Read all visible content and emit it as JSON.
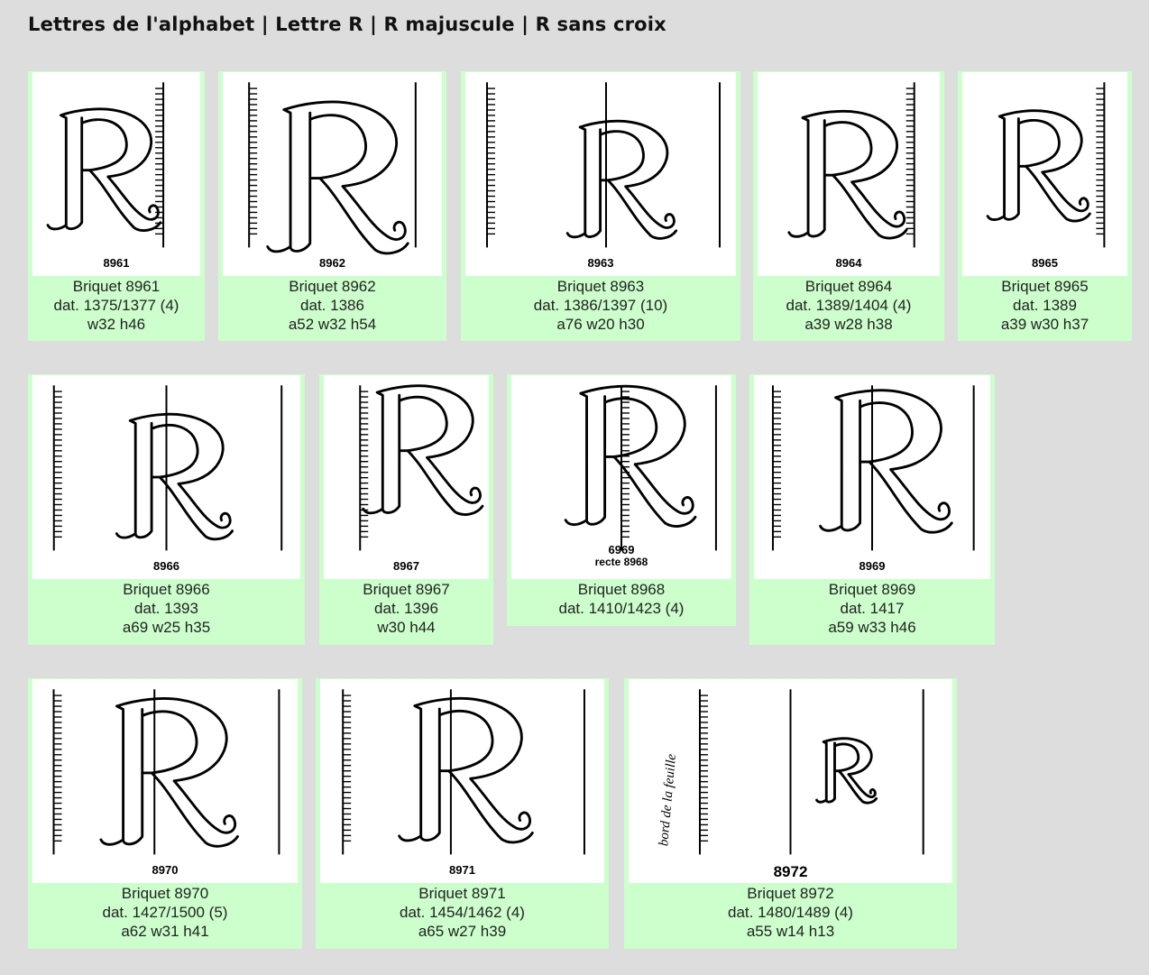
{
  "breadcrumb": "Lettres de l'alphabet | Lettre R | R majuscule | R sans croix",
  "cards": [
    {
      "number": "8961",
      "title": "Briquet 8961",
      "date": "dat. 1375/1377 (4)",
      "dims": "w32 h46"
    },
    {
      "number": "8962",
      "title": "Briquet 8962",
      "date": "dat. 1386",
      "dims": "a52 w32 h54"
    },
    {
      "number": "8963",
      "title": "Briquet 8963",
      "date": "dat. 1386/1397 (10)",
      "dims": "a76 w20 h30"
    },
    {
      "number": "8964",
      "title": "Briquet 8964",
      "date": "dat. 1389/1404 (4)",
      "dims": "a39 w28 h38"
    },
    {
      "number": "8965",
      "title": "Briquet 8965",
      "date": "dat. 1389",
      "dims": "a39 w30 h37"
    },
    {
      "number": "8966",
      "title": "Briquet 8966",
      "date": "dat. 1393",
      "dims": "a69 w25 h35"
    },
    {
      "number": "8967",
      "title": "Briquet 8967",
      "date": "dat. 1396",
      "dims": "w30 h44"
    },
    {
      "number": "6969",
      "recte": "recte 8968",
      "title": "Briquet 8968",
      "date": "dat. 1410/1423 (4)",
      "dims": ""
    },
    {
      "number": "8969",
      "title": "Briquet 8969",
      "date": "dat. 1417",
      "dims": "a59 w33 h46"
    },
    {
      "number": "8970",
      "title": "Briquet 8970",
      "date": "dat. 1427/1500 (5)",
      "dims": "a62 w31 h41"
    },
    {
      "number": "8971",
      "title": "Briquet 8971",
      "date": "dat. 1454/1462 (4)",
      "dims": "a65 w27 h39"
    },
    {
      "number": "8972",
      "title": "Briquet 8972",
      "date": "dat. 1480/1489 (4)",
      "dims": "a55 w14 h13",
      "margin_note": "bord de la feuille"
    }
  ],
  "colors": {
    "page_background": "#dddddd",
    "card_background": "#ccffcc",
    "image_background": "#ffffff"
  }
}
